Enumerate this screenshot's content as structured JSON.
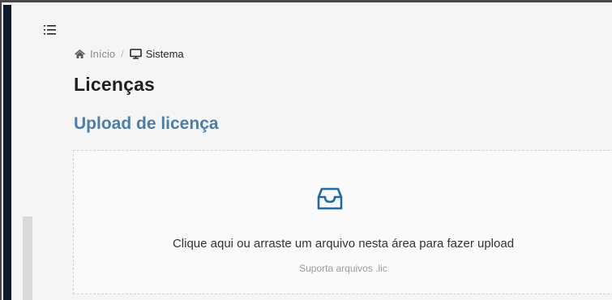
{
  "breadcrumb": {
    "home_label": "Início",
    "separator": "/",
    "current_label": "Sistema"
  },
  "page": {
    "title": "Licenças",
    "section_title": "Upload de licença"
  },
  "upload": {
    "instruction": "Clique aqui ou arraste um arquivo nesta área para fazer upload",
    "hint": "Suporta arquivos .lic"
  },
  "icons": {
    "menu": "menu-toggle-icon",
    "home": "home-icon",
    "system": "desktop-icon",
    "inbox": "inbox-icon"
  },
  "colors": {
    "sidebar": "#0f1c2e",
    "accent": "#1f6aa5",
    "section_title": "#4f7da3"
  }
}
